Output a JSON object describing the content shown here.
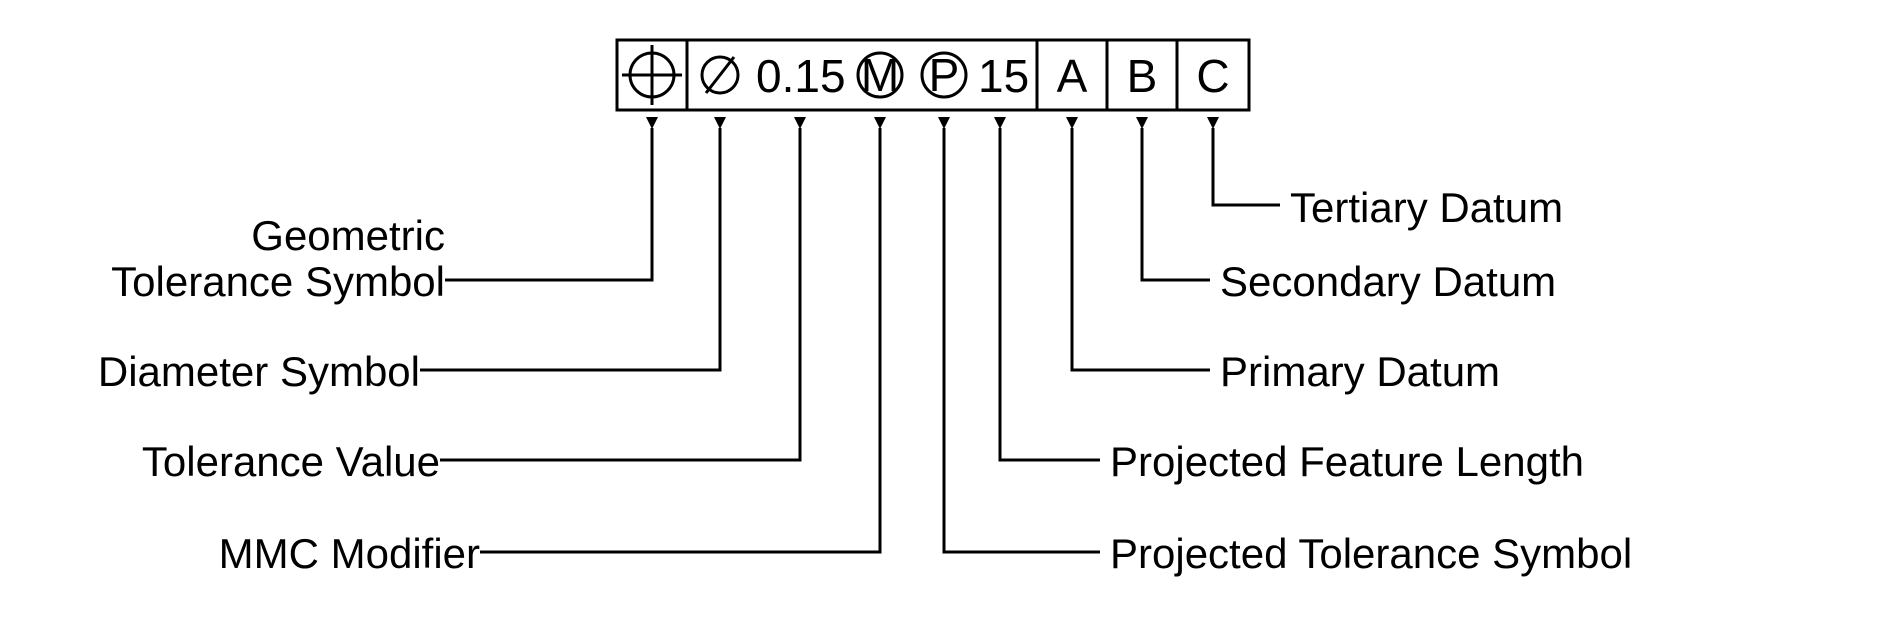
{
  "fcf": {
    "tolerance_value": "0.15",
    "mmc_letter": "M",
    "projected_letter": "P",
    "projected_length": "15",
    "primary_datum": "A",
    "secondary_datum": "B",
    "tertiary_datum": "C"
  },
  "labels": {
    "geom_symbol_1": "Geometric",
    "geom_symbol_2": "Tolerance Symbol",
    "diameter": "Diameter Symbol",
    "tolerance_value": "Tolerance Value",
    "mmc": "MMC Modifier",
    "projected_symbol": "Projected Tolerance Symbol",
    "projected_length": "Projected Feature Length",
    "primary": "Primary Datum",
    "secondary": "Secondary Datum",
    "tertiary": "Tertiary Datum"
  }
}
